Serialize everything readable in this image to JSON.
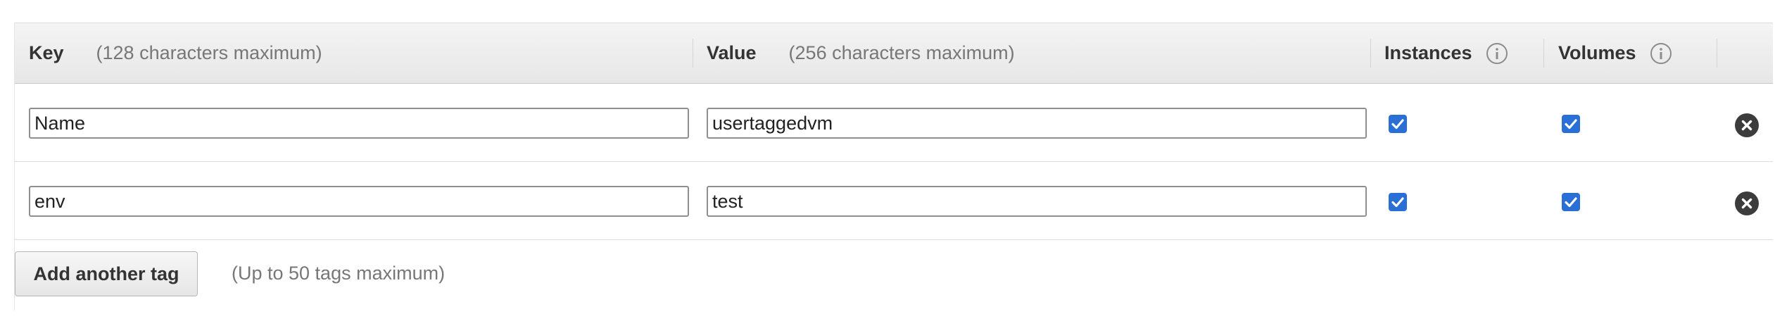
{
  "header": {
    "key_title": "Key",
    "key_hint": "(128 characters maximum)",
    "value_title": "Value",
    "value_hint": "(256 characters maximum)",
    "instances_title": "Instances",
    "volumes_title": "Volumes"
  },
  "rows": [
    {
      "key": "Name",
      "value": "usertaggedvm",
      "instances_checked": true,
      "volumes_checked": true
    },
    {
      "key": "env",
      "value": "test",
      "instances_checked": true,
      "volumes_checked": true
    }
  ],
  "footer": {
    "add_button_label": "Add another tag",
    "limit_text": "(Up to 50 tags maximum)"
  },
  "colors": {
    "checkbox": "#2a6fd6",
    "remove_icon": "#3c3c3c",
    "header_bg": "#ececec"
  },
  "icons": [
    "info-icon",
    "checkbox-checked-icon",
    "remove-circle-icon"
  ]
}
